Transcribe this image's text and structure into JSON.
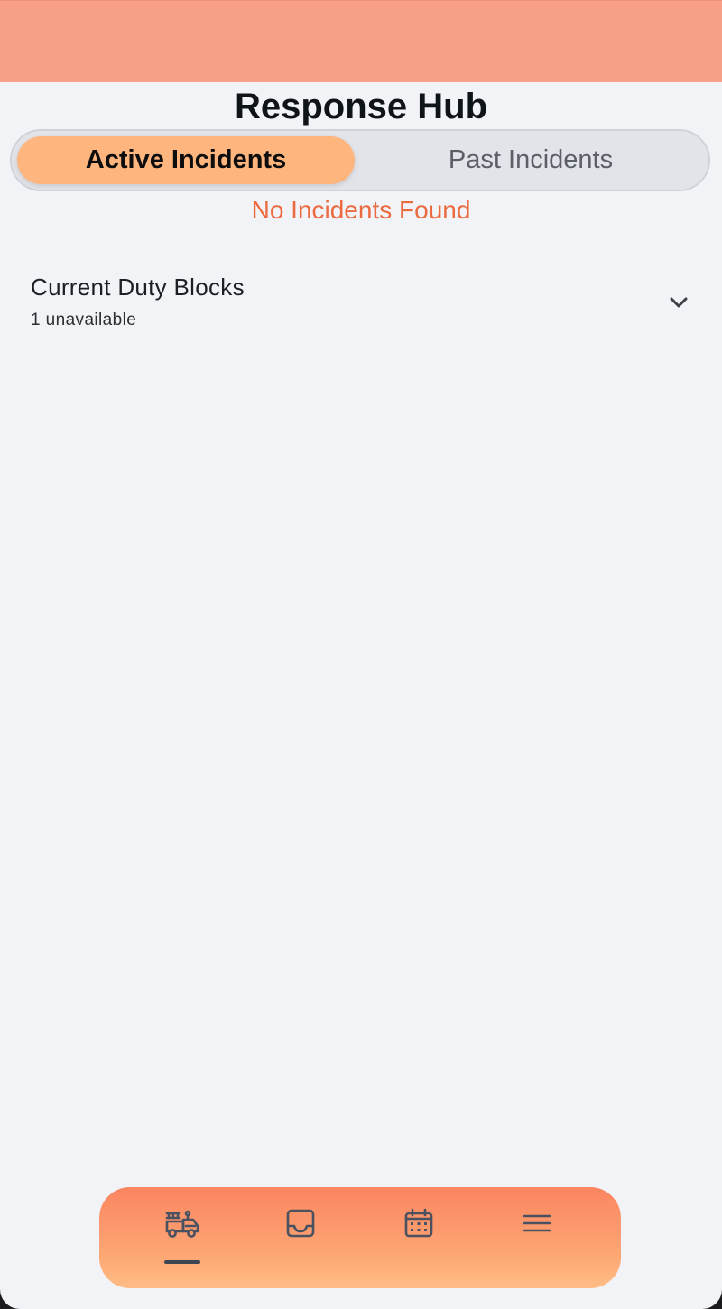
{
  "app": {
    "title": "Response Hub"
  },
  "tabs": {
    "active_label": "Active Incidents",
    "past_label": "Past Incidents",
    "selected": "Active Incidents"
  },
  "incidents": {
    "empty_message": "No Incidents Found"
  },
  "duty_blocks": {
    "title": "Current Duty Blocks",
    "subtitle": "1 unavailable",
    "expand_icon": "chevron-down-icon"
  },
  "bottom_nav": {
    "items": [
      {
        "icon": "fire-truck-icon",
        "active": true
      },
      {
        "icon": "inbox-icon",
        "active": false
      },
      {
        "icon": "calendar-icon",
        "active": false
      },
      {
        "icon": "menu-icon",
        "active": false
      }
    ]
  },
  "colors": {
    "header": "#f8a085",
    "background": "#f2f3f7",
    "active_tab": "#ffb57e",
    "empty_message": "#ec6a3f",
    "nav_gradient_top": "#fb8560",
    "nav_gradient_bottom": "#ffbd85",
    "nav_icon": "#4a5160"
  }
}
